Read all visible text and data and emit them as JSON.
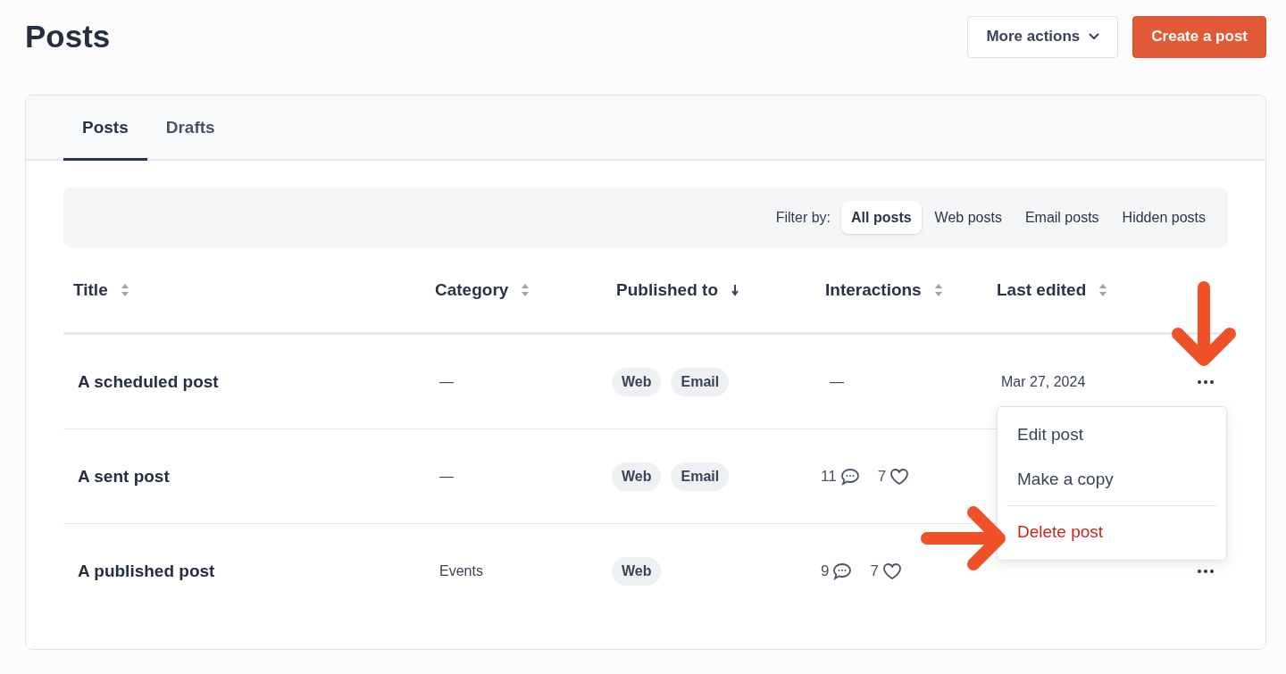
{
  "page": {
    "title": "Posts"
  },
  "header_actions": [
    {
      "label": "More actions",
      "kind": "secondary",
      "dropdown": true
    },
    {
      "label": "Create a post",
      "kind": "primary",
      "dropdown": false
    }
  ],
  "tabs": [
    {
      "label": "Posts",
      "selected": true
    },
    {
      "label": "Drafts",
      "selected": false
    }
  ],
  "filter": {
    "label": "Filter by:",
    "options": [
      {
        "label": "All posts",
        "selected": true
      },
      {
        "label": "Web posts",
        "selected": false
      },
      {
        "label": "Email posts",
        "selected": false
      },
      {
        "label": "Hidden posts",
        "selected": false
      }
    ]
  },
  "table": {
    "columns": [
      {
        "label": "Title",
        "sorted": false
      },
      {
        "label": "Category",
        "sorted": false
      },
      {
        "label": "Published to",
        "sorted": true
      },
      {
        "label": "Interactions",
        "sorted": false
      },
      {
        "label": "Last edited",
        "sorted": false
      }
    ],
    "rows": [
      {
        "title": "A scheduled post",
        "category": "—",
        "published_to": [
          "Web",
          "Email"
        ],
        "interactions": {
          "empty": "—"
        },
        "last_edited": "Mar 27, 2024"
      },
      {
        "title": "A sent post",
        "category": "—",
        "published_to": [
          "Web",
          "Email"
        ],
        "interactions": {
          "comments": "11",
          "likes": "7"
        }
      },
      {
        "title": "A published post",
        "category": "Events",
        "published_to": [
          "Web"
        ],
        "interactions": {
          "comments": "9",
          "likes": "7"
        }
      }
    ]
  },
  "row_menu": {
    "items": [
      {
        "label": "Edit post",
        "kind": "normal"
      },
      {
        "label": "Make a copy",
        "kind": "normal"
      },
      {
        "label": "Delete post",
        "kind": "danger"
      }
    ]
  }
}
